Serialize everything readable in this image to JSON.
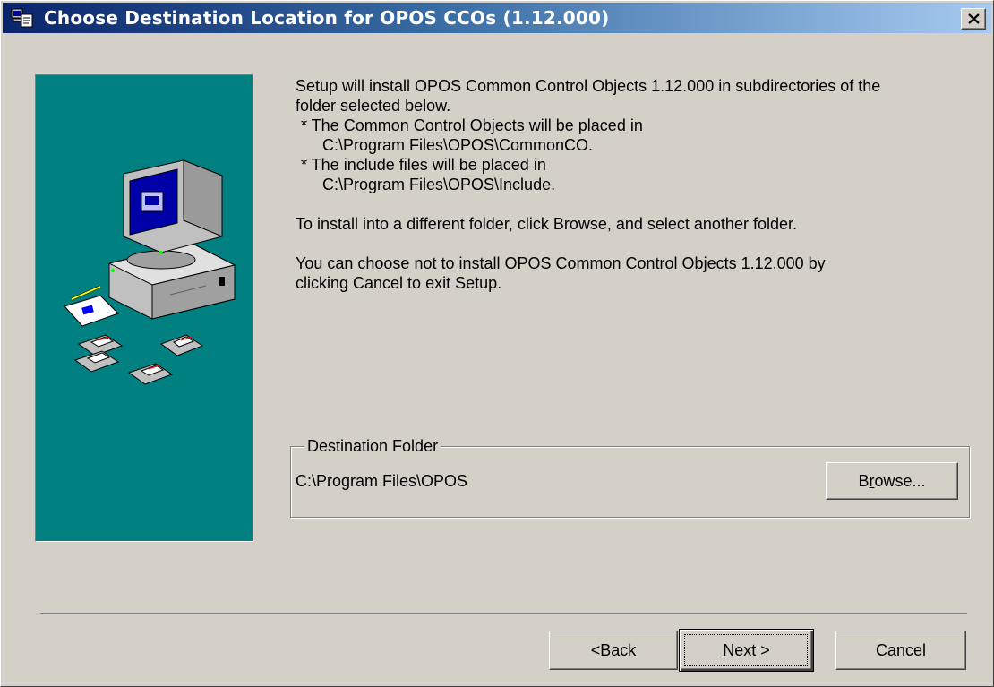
{
  "window": {
    "title": "Choose Destination Location for OPOS CCOs (1.12.000)",
    "close_label": "×"
  },
  "body": {
    "line1": "Setup will install OPOS Common Control Objects 1.12.000 in subdirectories of the",
    "line2": "folder selected below.",
    "bullet1": "* The Common Control Objects will be placed in",
    "path1": "C:\\Program Files\\OPOS\\CommonCO.",
    "bullet2": "* The include files will be placed in",
    "path2": "C:\\Program Files\\OPOS\\Include.",
    "browse_hint": "To install into a different folder, click Browse, and select another folder.",
    "cancel_hint_1": "You can choose not to install OPOS Common Control Objects 1.12.000 by",
    "cancel_hint_2": "clicking Cancel to exit Setup."
  },
  "destination": {
    "group_label": "Destination Folder",
    "path": "C:\\Program Files\\OPOS",
    "browse_pre": "B",
    "browse_ul": "r",
    "browse_post": "owse..."
  },
  "buttons": {
    "back_pre": "< ",
    "back_ul": "B",
    "back_post": "ack",
    "next_ul": "N",
    "next_post": "ext >",
    "cancel": "Cancel"
  },
  "colors": {
    "title_gradient_start": "#0a246a",
    "title_gradient_end": "#a6caf0",
    "art_background": "#008080",
    "dialog_face": "#d4d0c8"
  }
}
